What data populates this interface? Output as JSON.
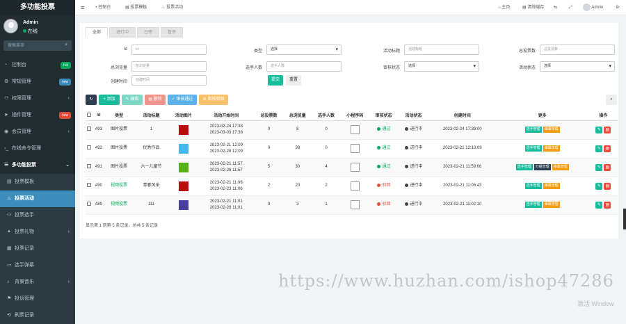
{
  "sidebar": {
    "brand": "多功能投票",
    "user": {
      "name": "Admin",
      "status": "在线"
    },
    "search_placeholder": "搜索菜单",
    "menu": [
      {
        "label": "控制台",
        "icon": "dashboard-icon",
        "badge": "hot",
        "badge_color": "#00a65a"
      },
      {
        "label": "常规管理",
        "icon": "cog-icon",
        "badge": "new",
        "badge_color": "#3c8dbc"
      },
      {
        "label": "权限管理",
        "icon": "group-icon",
        "chevron": "‹"
      },
      {
        "label": "插件管理",
        "icon": "rocket-icon",
        "badge": "new",
        "badge_color": "#dd4b39"
      },
      {
        "label": "会员管理",
        "icon": "user-icon",
        "chevron": "‹"
      },
      {
        "label": "在线命令管理",
        "icon": "terminal-icon"
      },
      {
        "label": "多功能投票",
        "icon": "list-icon",
        "chevron": "⌄"
      }
    ],
    "submenu": [
      {
        "label": "投票模板",
        "icon": "file-icon"
      },
      {
        "label": "投票活动",
        "icon": "fire-icon",
        "active": true
      },
      {
        "label": "投票选手",
        "icon": "users-icon"
      },
      {
        "label": "投票礼物",
        "icon": "gift-icon",
        "chevron": "‹"
      },
      {
        "label": "投票记录",
        "icon": "list-alt-icon"
      },
      {
        "label": "选手弹幕",
        "icon": "comment-icon"
      },
      {
        "label": "背景音乐",
        "icon": "music-icon",
        "chevron": "‹"
      },
      {
        "label": "投诉管理",
        "icon": "flag-icon"
      },
      {
        "label": "刷票记录",
        "icon": "history-icon"
      }
    ]
  },
  "topbar": {
    "tabs": [
      {
        "label": "控制台",
        "icon": "dashboard-icon"
      },
      {
        "label": "投票模板",
        "icon": "file-icon"
      },
      {
        "label": "投票活动",
        "icon": "fire-icon"
      }
    ],
    "right": {
      "home": "主页",
      "clear_cache": "清除缓存",
      "user": "Admin"
    }
  },
  "filters": {
    "tabs": [
      "全部",
      "进行中",
      "已停",
      "暂停"
    ],
    "fields": [
      {
        "label": "Id",
        "placeholder": "Id",
        "type": "input"
      },
      {
        "label": "类型",
        "value": "选择",
        "type": "select"
      },
      {
        "label": "活动标题",
        "placeholder": "活动标题",
        "type": "input"
      },
      {
        "label": "总投票数",
        "placeholder": "总投票数",
        "type": "input"
      },
      {
        "label": "总浏览量",
        "placeholder": "总浏览量",
        "type": "input"
      },
      {
        "label": "选手人数",
        "placeholder": "选手人数",
        "type": "input"
      },
      {
        "label": "审核状态",
        "value": "选择",
        "type": "select"
      },
      {
        "label": "活动状态",
        "value": "选择",
        "type": "select"
      },
      {
        "label": "创建时间",
        "placeholder": "创建时间",
        "type": "input"
      }
    ],
    "submit": "提交",
    "reset": "重置"
  },
  "toolbar": {
    "add": "添加",
    "edit": "编辑",
    "delete": "删除",
    "approve": "审核通过",
    "reject": "审核驳回"
  },
  "table": {
    "headers": [
      "Id",
      "类型",
      "活动标题",
      "活动图片",
      "活动开始时间",
      "总投票数",
      "总浏览量",
      "选手人数",
      "小程序码",
      "审核状态",
      "活动状态",
      "创建时间",
      "更多",
      "操作"
    ],
    "rows": [
      {
        "id": "493",
        "type": "图片投票",
        "type_color": "#333",
        "title": "1",
        "img": "#b70c0c",
        "start": "2023-02-24 17:38",
        "end": "2023-03-03 17:38",
        "votes": "0",
        "views": "8",
        "players": "0",
        "audit": "通过",
        "audit_color": "#00a65a",
        "status": "进行中",
        "status_color": "#555",
        "created": "2023-02-24 17:39:00",
        "more": [
          "选手管理",
          "弹幕管理"
        ]
      },
      {
        "id": "492",
        "type": "图片投票",
        "type_color": "#333",
        "title": "优秀作品",
        "img": "#44b7f0",
        "start": "2023-02-21 12:09",
        "end": "2023-02-28 12:09",
        "votes": "0",
        "views": "39",
        "players": "0",
        "audit": "通过",
        "audit_color": "#00a65a",
        "status": "进行中",
        "status_color": "#555",
        "created": "2023-02-21 12:10:09",
        "more": [
          "选手管理",
          "弹幕管理"
        ]
      },
      {
        "id": "491",
        "type": "图片投票",
        "type_color": "#333",
        "title": "六一儿童节",
        "img": "#57b21a",
        "start": "2023-02-21 11:57",
        "end": "2023-02-26 11:57",
        "votes": "5",
        "views": "30",
        "players": "4",
        "audit": "通过",
        "audit_color": "#00a65a",
        "status": "进行中",
        "status_color": "#555",
        "created": "2023-02-21 11:59:06",
        "more": [
          "选手管理",
          "分组管理",
          "弹幕管理"
        ]
      },
      {
        "id": "490",
        "type": "视频投票",
        "type_color": "#00a65a",
        "title": "青春风采",
        "img": "#b70c0c",
        "start": "2023-02-21 11:06",
        "end": "2023-02-23 11:06",
        "votes": "2",
        "views": "20",
        "players": "2",
        "audit": "驳回",
        "audit_color": "#dd4b39",
        "status": "进行中",
        "status_color": "#555",
        "created": "2023-02-21 11:06:43",
        "more": [
          "选手管理",
          "弹幕管理"
        ]
      },
      {
        "id": "489",
        "type": "视频投票",
        "type_color": "#00a65a",
        "title": "111",
        "img": "#473ea0",
        "start": "2023-02-21 11:01",
        "end": "2023-02-28 11:01",
        "votes": "0",
        "views": "3",
        "players": "1",
        "audit": "驳回",
        "audit_color": "#dd4b39",
        "status": "进行中",
        "status_color": "#555",
        "created": "2023-02-21 11:02:10",
        "more": [
          "选手管理",
          "弹幕管理"
        ]
      }
    ]
  },
  "pager": "显示第 1 到第 5 条记录，总共 5 条记录",
  "watermark": "https://www.huzhan.com/ishop47286",
  "activation": "激活 Window"
}
